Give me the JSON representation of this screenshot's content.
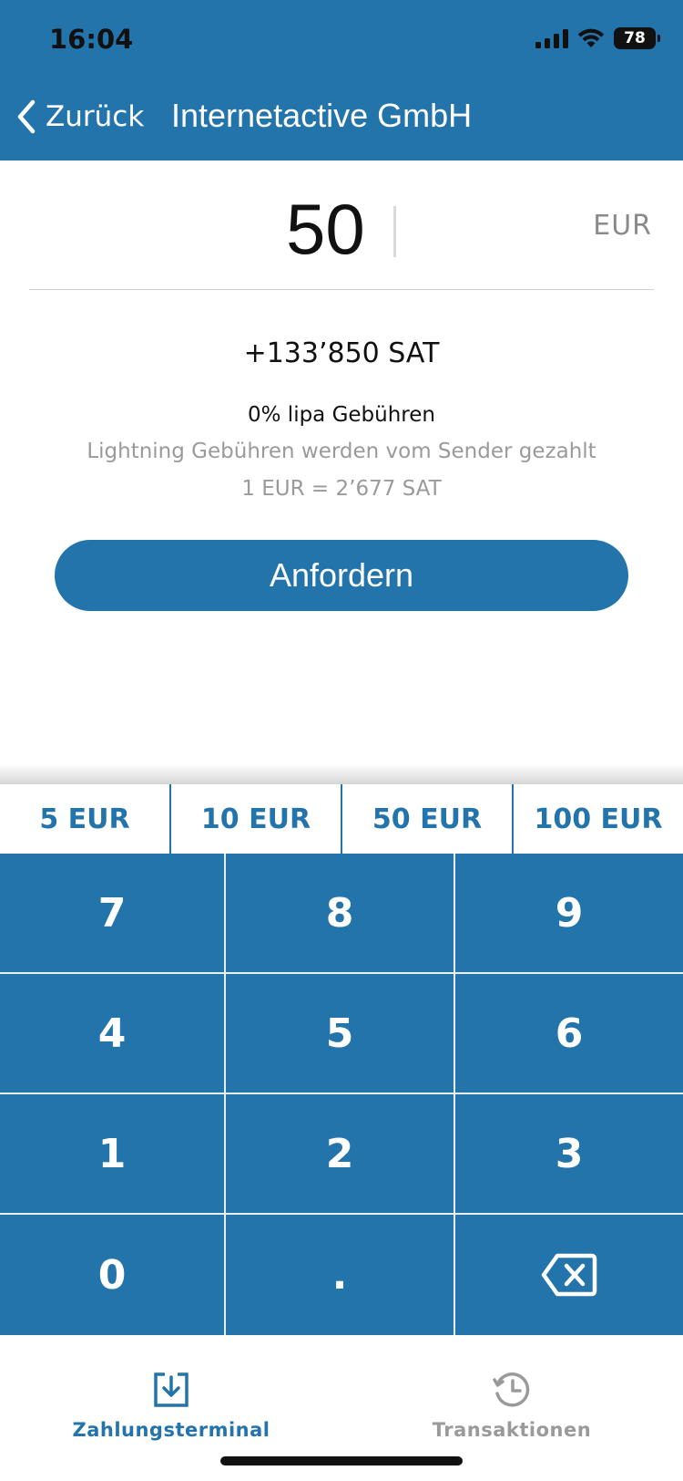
{
  "status_bar": {
    "time": "16:04",
    "battery": "78"
  },
  "nav": {
    "back_label": "Zurück",
    "title": "Internetactive GmbH"
  },
  "amount": {
    "value": "50",
    "currency": "EUR"
  },
  "conversion": {
    "sat": "+133’850 SAT",
    "fee": "0% lipa Gebühren",
    "fee_note": "Lightning Gebühren werden vom Sender gezahlt",
    "rate": "1 EUR = 2’677 SAT"
  },
  "request_button": {
    "label": "Anfordern"
  },
  "quick_amounts": [
    "5 EUR",
    "10 EUR",
    "50 EUR",
    "100 EUR"
  ],
  "keypad": {
    "keys": [
      "7",
      "8",
      "9",
      "4",
      "5",
      "6",
      "1",
      "2",
      "3",
      "0",
      "."
    ],
    "backspace_icon": "backspace-icon"
  },
  "tabbar": {
    "terminal_label": "Zahlungsterminal",
    "transactions_label": "Transaktionen",
    "active_color": "#2474ac",
    "inactive_color": "#9a9a9a"
  },
  "colors": {
    "primary": "#2474ac",
    "text": "#111111",
    "muted": "#9a9a9a"
  }
}
